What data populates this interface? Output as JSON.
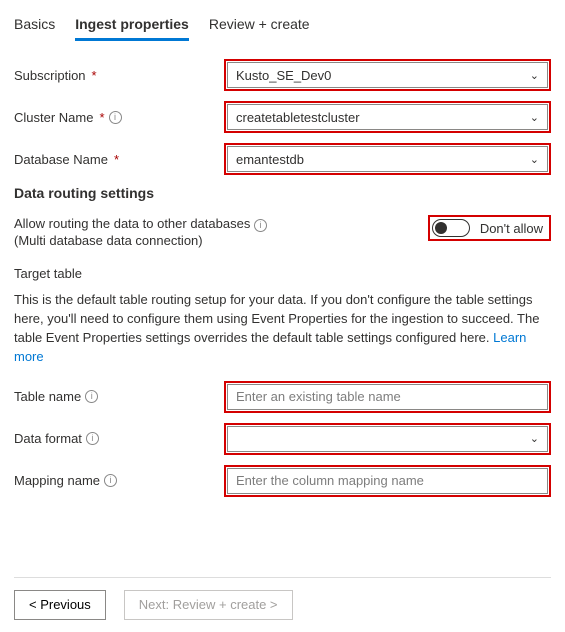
{
  "tabs": {
    "basics": "Basics",
    "ingest": "Ingest properties",
    "review": "Review + create"
  },
  "fields": {
    "subscription": {
      "label": "Subscription",
      "value": "Kusto_SE_Dev0"
    },
    "cluster": {
      "label": "Cluster Name",
      "value": "createtabletestcluster"
    },
    "database": {
      "label": "Database Name",
      "value": "emantestdb"
    }
  },
  "routing": {
    "heading": "Data routing settings",
    "line1": "Allow routing the data to other databases",
    "line2": "(Multi database data connection)",
    "toggle_label": "Don't allow"
  },
  "target": {
    "heading": "Target table",
    "desc": "This is the default table routing setup for your data. If you don't configure the table settings here, you'll need to configure them using Event Properties for the ingestion to succeed. The table Event Properties settings overrides the default table settings configured here. ",
    "learn_more": "Learn more",
    "table_name_label": "Table name",
    "table_name_placeholder": "Enter an existing table name",
    "data_format_label": "Data format",
    "mapping_label": "Mapping name",
    "mapping_placeholder": "Enter the column mapping name"
  },
  "footer": {
    "previous": "<  Previous",
    "next": "Next: Review + create  >"
  }
}
